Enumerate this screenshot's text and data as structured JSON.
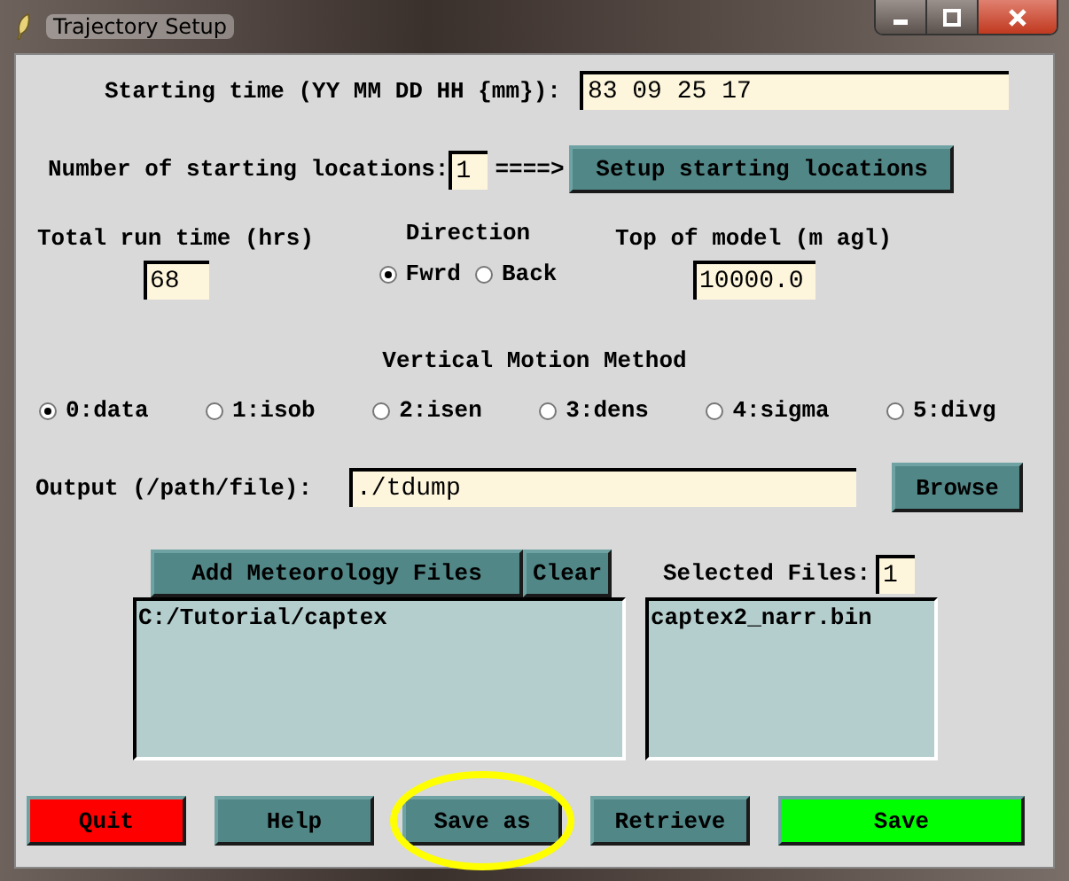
{
  "window": {
    "title": "Trajectory Setup"
  },
  "starting_time": {
    "label": "Starting time (YY MM DD HH {mm}):",
    "value": "83 09 25 17"
  },
  "locations": {
    "label": "Number of starting locations:",
    "value": "1",
    "arrow": "====>",
    "button": "Setup starting locations"
  },
  "run_time": {
    "label": "Total run time (hrs)",
    "value": "68"
  },
  "direction": {
    "label": "Direction",
    "options": [
      {
        "label": "Fwrd",
        "selected": true
      },
      {
        "label": "Back",
        "selected": false
      }
    ]
  },
  "top_of_model": {
    "label": "Top of model (m agl)",
    "value": "10000.0"
  },
  "vertical_motion": {
    "label": "Vertical Motion Method",
    "options": [
      {
        "label": "0:data",
        "selected": true
      },
      {
        "label": "1:isob",
        "selected": false
      },
      {
        "label": "2:isen",
        "selected": false
      },
      {
        "label": "3:dens",
        "selected": false
      },
      {
        "label": "4:sigma",
        "selected": false
      },
      {
        "label": "5:divg",
        "selected": false
      }
    ]
  },
  "output": {
    "label": "Output (/path/file):",
    "value": "./tdump",
    "button": "Browse"
  },
  "met_files": {
    "add_button": "Add Meteorology Files",
    "clear_button": "Clear",
    "directories": [
      "C:/Tutorial/captex"
    ]
  },
  "selected_files": {
    "label": "Selected Files:",
    "count": "1",
    "files": [
      "captex2_narr.bin"
    ]
  },
  "buttons": [
    {
      "label": "Quit",
      "color": "#ff0000",
      "circled": false
    },
    {
      "label": "Help",
      "color": "#528787",
      "circled": false
    },
    {
      "label": "Save as",
      "color": "#528787",
      "circled": true
    },
    {
      "label": "Retrieve",
      "color": "#528787",
      "circled": false
    },
    {
      "label": "Save",
      "color": "#00ff00",
      "circled": false
    }
  ]
}
